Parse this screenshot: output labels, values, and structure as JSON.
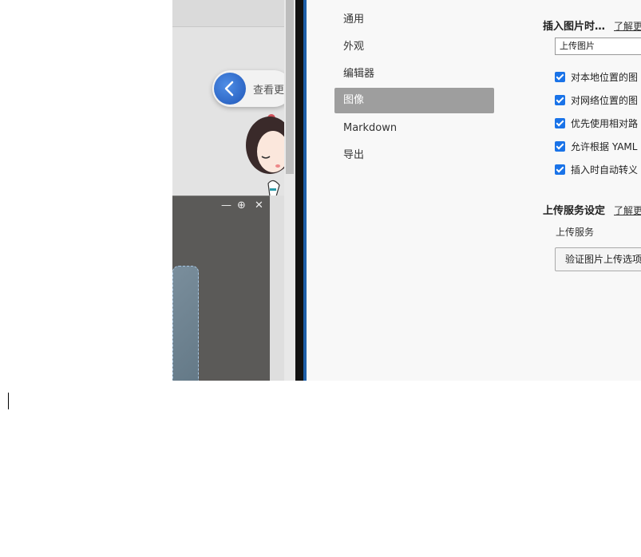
{
  "background_app": {
    "back_label": "查看更",
    "window_controls": [
      "—",
      "⊕",
      "✕"
    ],
    "back_icon": "chevron-left-icon"
  },
  "prefs": {
    "nav": [
      {
        "label": "通用",
        "active": false
      },
      {
        "label": "外观",
        "active": false
      },
      {
        "label": "编辑器",
        "active": false
      },
      {
        "label": "图像",
        "active": true
      },
      {
        "label": "Markdown",
        "active": false
      },
      {
        "label": "导出",
        "active": false
      }
    ],
    "insert_section": {
      "title": "插入图片时…",
      "learn_more": "了解更",
      "select_value": "上传图片",
      "checkboxes": [
        {
          "label": "对本地位置的图",
          "checked": true
        },
        {
          "label": "对网络位置的图",
          "checked": true
        },
        {
          "label": "优先使用相对路",
          "checked": true
        },
        {
          "label": "允许根据 YAML",
          "checked": true
        },
        {
          "label": "插入时自动转义",
          "checked": true
        }
      ]
    },
    "upload_section": {
      "title": "上传服务设定",
      "learn_more": "了解更",
      "service_label": "上传服务",
      "verify_button": "验证图片上传选项"
    }
  },
  "colors": {
    "accent": "#1a73e8",
    "nav_active": "#9e9e9e",
    "separator_blue": "#1d5fa8"
  }
}
